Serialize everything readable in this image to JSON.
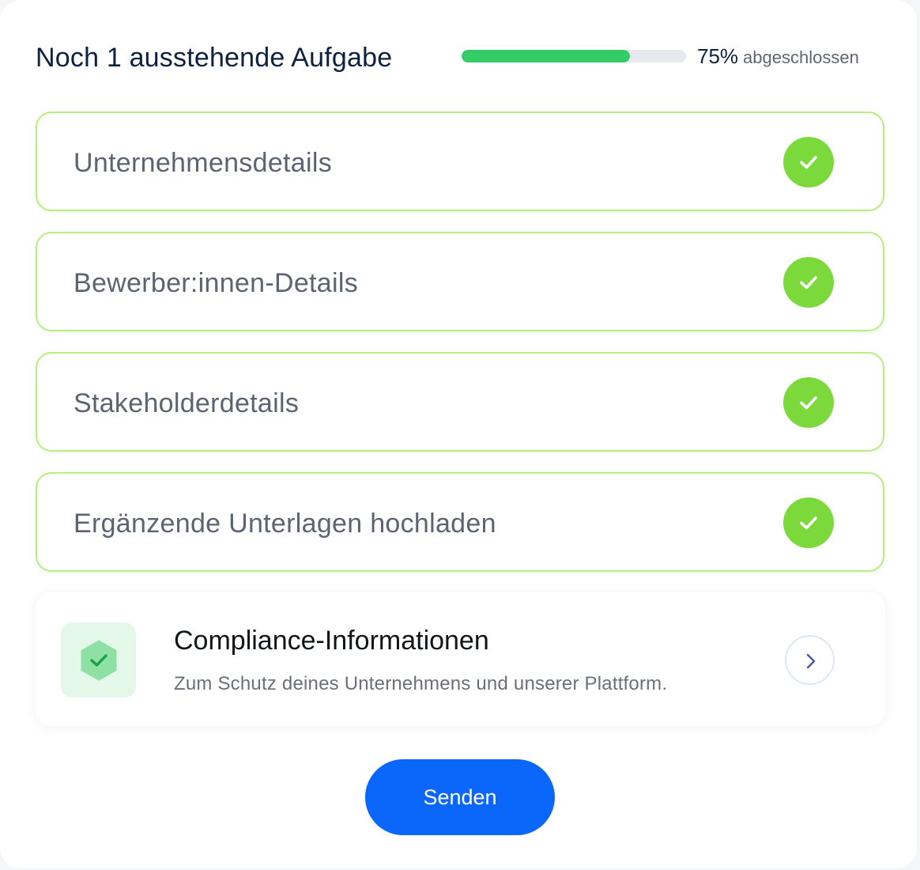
{
  "header": {
    "title": "Noch 1 ausstehende Aufgabe",
    "progress_percent": 75,
    "progress_value_text": "75%",
    "progress_label": "abgeschlossen"
  },
  "tasks": [
    {
      "label": "Unternehmensdetails",
      "status": "complete",
      "icon": "check-icon"
    },
    {
      "label": "Bewerber:innen-Details",
      "status": "complete",
      "icon": "check-icon"
    },
    {
      "label": "Stakeholderdetails",
      "status": "complete",
      "icon": "check-icon"
    },
    {
      "label": "Ergänzende Unterlagen hochladen",
      "status": "complete",
      "icon": "check-icon"
    }
  ],
  "compliance": {
    "title": "Compliance-Informationen",
    "subtitle": "Zum Schutz deines Unternehmens und unserer Plattform.",
    "icon": "shield-check-icon",
    "action_icon": "chevron-right-icon"
  },
  "submit": {
    "label": "Senden"
  },
  "colors": {
    "accent": "#0b66fb",
    "progress": "#33cc66",
    "check": "#7bd93b",
    "task_border": "#b6ee80",
    "title": "#0d2240"
  }
}
